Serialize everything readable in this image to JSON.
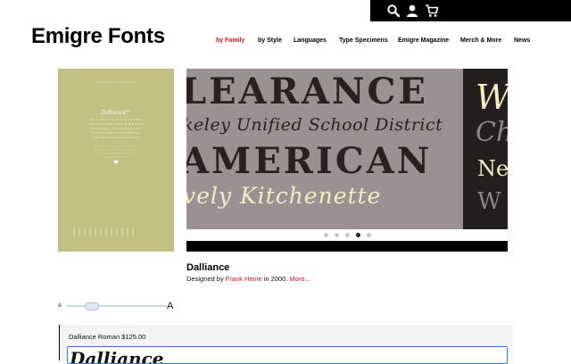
{
  "header": {
    "logo": "Emigre Fonts",
    "icons": [
      "search-icon",
      "account-icon",
      "cart-icon"
    ]
  },
  "nav": {
    "items": [
      {
        "label": "by Family",
        "active": true
      },
      {
        "label": "by Style"
      },
      {
        "label": "Languages"
      },
      {
        "label": "Type Specimens"
      },
      {
        "label": "Emigre Magazine"
      },
      {
        "label": "Merch & More"
      },
      {
        "label": "News"
      }
    ]
  },
  "cover": {
    "title": "Dalliance™"
  },
  "slider": {
    "lines": [
      "LEARANCE",
      "keley Unified School District",
      "AMERICAN",
      "vely Kitchenette"
    ],
    "side_lines": [
      "W",
      "Ch",
      "Ne",
      "W"
    ],
    "dot_count": 5,
    "active_dot": 4
  },
  "family": {
    "name": "Dalliance",
    "designed_prefix": "Designed by",
    "designer": "Frank Heine",
    "designed_suffix": "in 2000.",
    "more": "More..."
  },
  "sizer": {
    "small_label": "A",
    "big_label": "A",
    "level": 0.2
  },
  "purchase": {
    "line": "Dalliance Roman $125.00",
    "tester_text": "Dalliance"
  },
  "colors": {
    "accent": "#d4161b",
    "cover_bg": "#c4c083",
    "slide_bg": "#9b9192",
    "slide_text": "#2b2020",
    "slide_light": "#f3ecc4"
  }
}
